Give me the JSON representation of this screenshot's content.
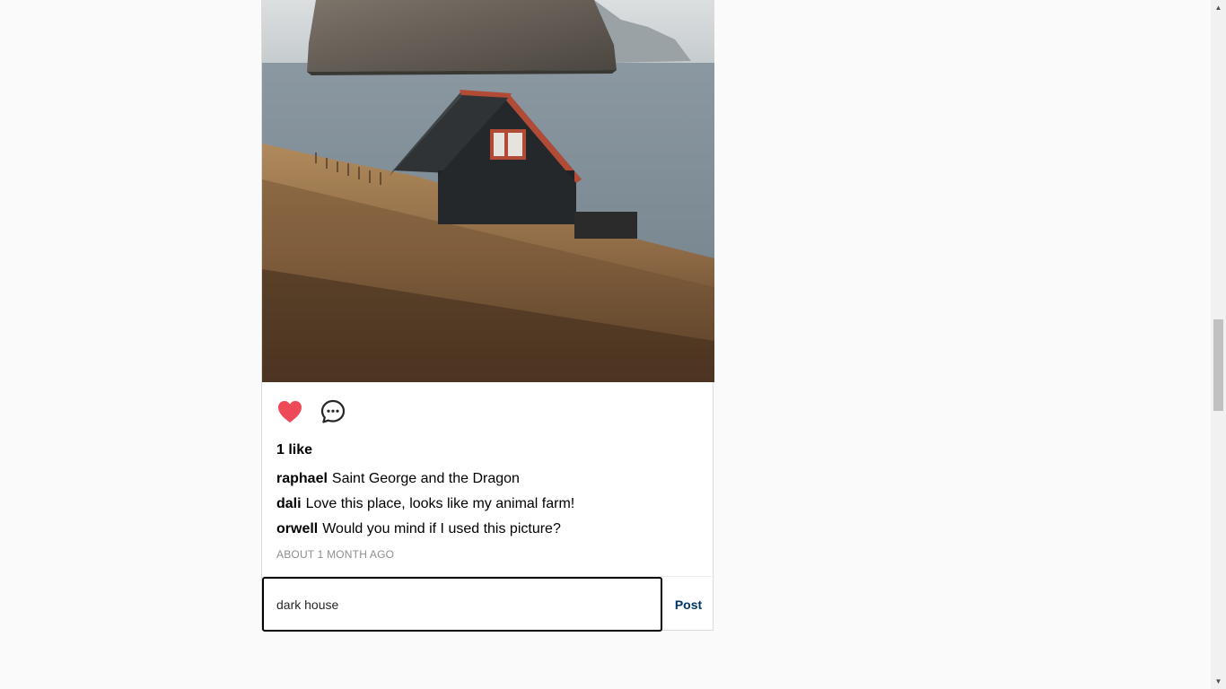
{
  "post": {
    "image_description_icon": "landscape-photo",
    "likes_text": "1 like",
    "comments": [
      {
        "user": "raphael",
        "text": "Saint George and the Dragon"
      },
      {
        "user": "dali",
        "text": "Love this place, looks like my animal farm!"
      },
      {
        "user": "orwell",
        "text": "Would you mind if I used this picture?"
      }
    ],
    "timestamp": "ABOUT 1 MONTH AGO",
    "liked": true
  },
  "comment_form": {
    "value": "dark house",
    "post_label": "Post"
  },
  "colors": {
    "like_red": "#ed4956",
    "post_blue": "#00376b"
  },
  "scrollbar": {
    "up_arrow": "▲",
    "down_arrow": "▼"
  }
}
